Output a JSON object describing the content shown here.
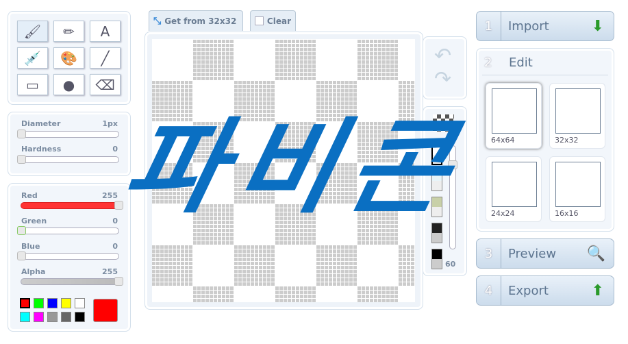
{
  "tools": [
    {
      "name": "brush-tool",
      "icon": "🖌",
      "selected": true
    },
    {
      "name": "pencil-tool",
      "icon": "✏"
    },
    {
      "name": "text-tool",
      "icon": "A"
    },
    {
      "name": "eyedropper-tool",
      "icon": "💉"
    },
    {
      "name": "fill-tool",
      "icon": "🎨"
    },
    {
      "name": "line-tool",
      "icon": "╱"
    },
    {
      "name": "rectangle-tool",
      "icon": "▭"
    },
    {
      "name": "ellipse-tool",
      "icon": "●"
    },
    {
      "name": "eraser-tool",
      "icon": "⌫"
    }
  ],
  "brush": {
    "diameter_label": "Diameter",
    "diameter_value": "1px",
    "hardness_label": "Hardness",
    "hardness_value": "0"
  },
  "color": {
    "red_label": "Red",
    "red_value": "255",
    "green_label": "Green",
    "green_value": "0",
    "blue_label": "Blue",
    "blue_value": "0",
    "alpha_label": "Alpha",
    "alpha_value": "255",
    "current": "#ff0000",
    "swatches": [
      "#ff0000",
      "#00ff00",
      "#0000ff",
      "#ffff00",
      "#ffffff",
      "#00ffff",
      "#ff00ff",
      "#999999",
      "#666666",
      "#000000"
    ]
  },
  "tabs": {
    "get_from": "Get from 32x32",
    "clear": "Clear"
  },
  "background": {
    "opacity_value": "60",
    "swatches": [
      "#ffffff",
      "#e8f4f8",
      "#c8d0a8",
      "#222222",
      "#000000"
    ]
  },
  "steps": {
    "import": {
      "num": "1",
      "label": "Import"
    },
    "edit": {
      "num": "2",
      "label": "Edit"
    },
    "preview": {
      "num": "3",
      "label": "Preview"
    },
    "export": {
      "num": "4",
      "label": "Export"
    }
  },
  "sizes": [
    "64x64",
    "32x32",
    "24x24",
    "16x16"
  ],
  "overlay_text": "파비콘"
}
